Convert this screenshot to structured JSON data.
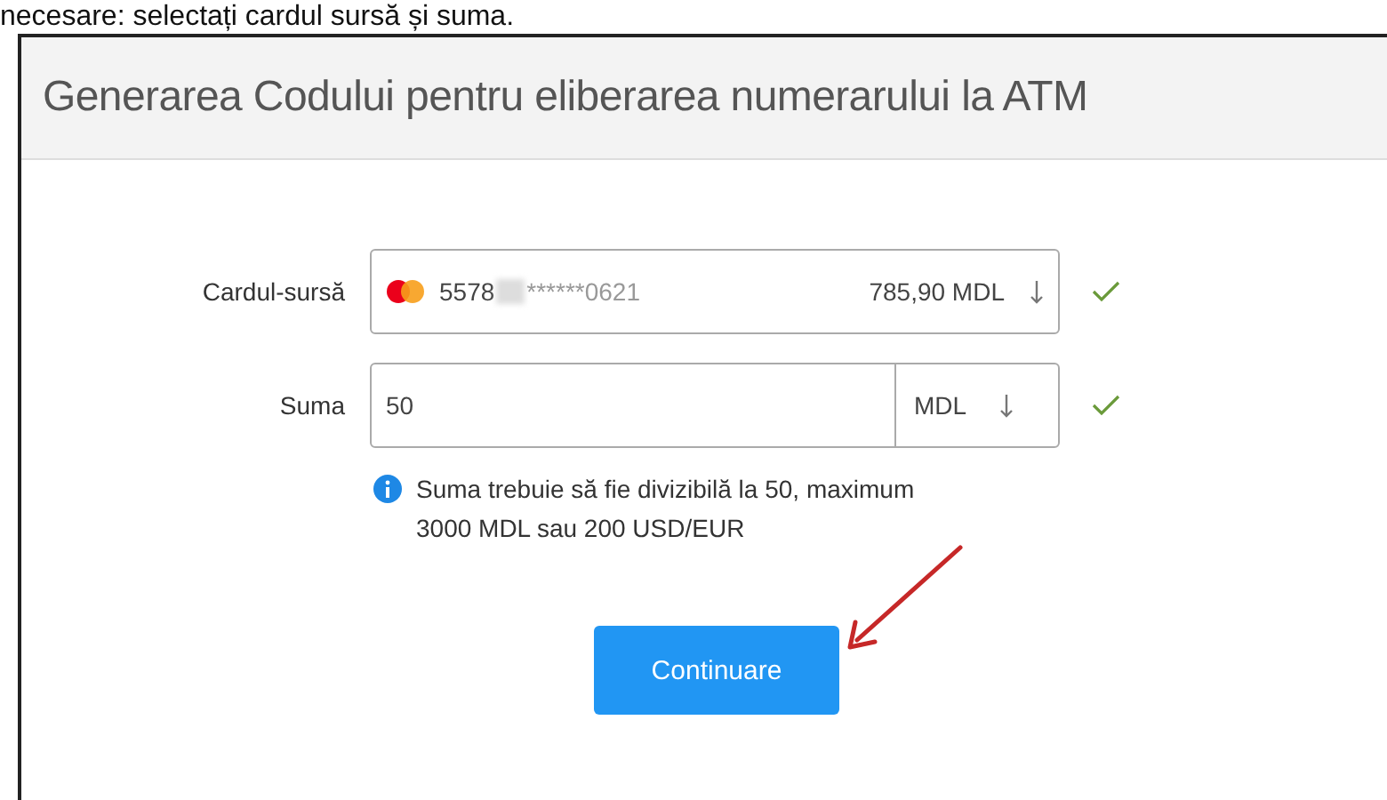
{
  "intro_text": "necesare: selectați cardul sursă și suma.",
  "panel": {
    "title": "Generarea Codului pentru eliberarea numerarului la ATM"
  },
  "form": {
    "card": {
      "label": "Cardul-sursă",
      "number_start": "5578",
      "number_end": "******0621",
      "balance": "785,90 MDL",
      "valid": true
    },
    "amount": {
      "label": "Suma",
      "value": "50",
      "currency": "MDL",
      "valid": true
    },
    "hint": "Suma trebuie să fie divizibilă la 50, maximum 3000 MDL sau 200 USD/EUR"
  },
  "submit_button": "Continuare"
}
